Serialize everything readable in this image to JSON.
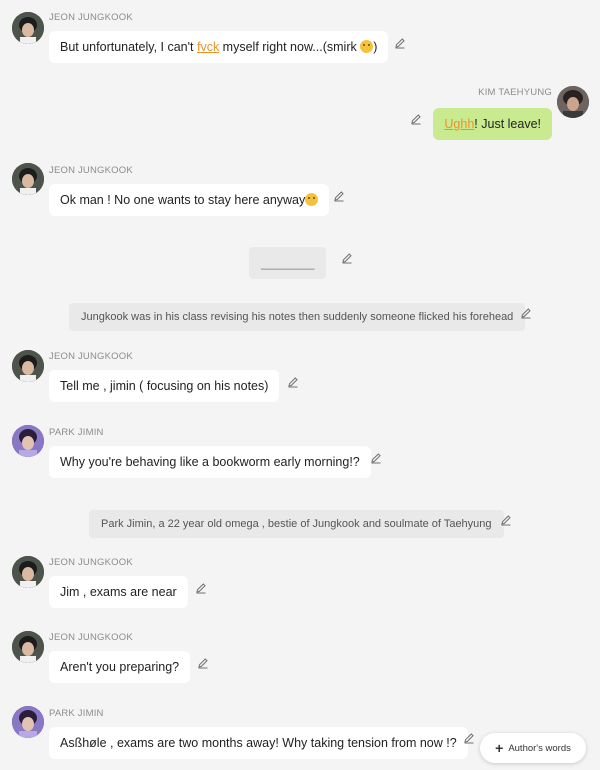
{
  "avatars": {
    "jungkook": "jungkook-avatar",
    "taehyung": "taehyung-avatar",
    "jimin": "jimin-avatar"
  },
  "colors": {
    "background": "#f4f4f4",
    "bubble": "#ffffff",
    "bubble_self": "#c9ea8e",
    "highlight": "#e8942c",
    "narration_bg": "#e9e9e9"
  },
  "messages": [
    {
      "sender": "JEON JUNGKOOK",
      "pre": "But unfortunately, I can't ",
      "hl": "fvck",
      "post": " myself right now...(smirk ",
      "tail": ")"
    },
    {
      "sender": "KIM TAEHYUNG",
      "hl": "Ughh",
      "post": "! Just leave!"
    },
    {
      "sender": "JEON JUNGKOOK",
      "text": "Ok man ! No one wants to stay here anyway"
    },
    {
      "blank": "________"
    },
    {
      "narration": "Jungkook was in his class revising his notes then suddenly someone flicked his forehead"
    },
    {
      "sender": "JEON JUNGKOOK",
      "text": "Tell me , jimin ( focusing on his notes)"
    },
    {
      "sender": "PARK JIMIN",
      "text": "Why you're behaving like a bookworm early morning!?"
    },
    {
      "narration": "Park Jimin, a 22 year old omega , bestie of Jungkook and soulmate of Taehyung"
    },
    {
      "sender": "JEON JUNGKOOK",
      "text": "Jim , exams are near"
    },
    {
      "sender": "JEON JUNGKOOK",
      "text": "Aren't you preparing?"
    },
    {
      "sender": "PARK JIMIN",
      "text": "Asßhøle , exams are two months away! Why taking tension from now !?"
    }
  ],
  "authors_button": {
    "label": "Author's words",
    "icon": "plus-icon"
  }
}
